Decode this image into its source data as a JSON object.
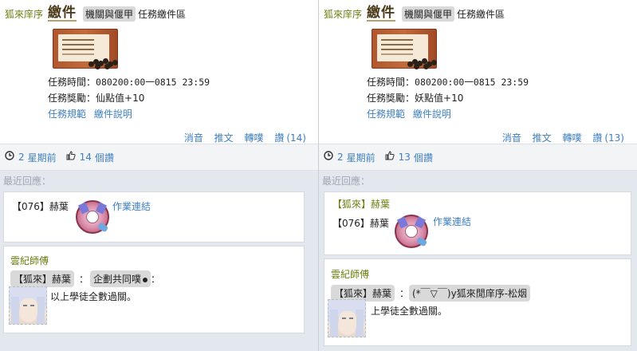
{
  "left": {
    "author": "狐來庠序",
    "logo": "繳件",
    "tag": "機關與偃甲",
    "area": "任務繳件區",
    "time_label": "任務時間：",
    "time_value": "080200:00一0815 23:59",
    "reward_label": "任務獎勵：",
    "reward_value": "仙點值+10",
    "rules_link": "任務規範",
    "guide_link": "繳件說明",
    "actions": {
      "mute": "消音",
      "tweet": "推文",
      "repost": "轉噗",
      "like": "讚",
      "like_count": "(14)"
    },
    "meta": {
      "time_num": "2",
      "time_unit": "星期前",
      "like_num": "14",
      "like_unit": "個讚"
    },
    "recent_label": "最近回應：",
    "reply1": {
      "tag": "【076】赫葉",
      "link": "作業連結"
    },
    "reply2": {
      "teacher": "雲紀師傅",
      "chip1": "【狐來】赫葉",
      "chip2": "企劃共同噗",
      "message": "以上學徒全數過關。"
    }
  },
  "right": {
    "author": "狐來庠序",
    "logo": "繳件",
    "tag": "機關與偃甲",
    "area": "任務繳件區",
    "time_label": "任務時間：",
    "time_value": "080200:00一0815 23:59",
    "reward_label": "任務獎勵：",
    "reward_value": "妖點值+10",
    "rules_link": "任務規範",
    "guide_link": "繳件說明",
    "actions": {
      "mute": "消音",
      "tweet": "推文",
      "repost": "轉噗",
      "like": "讚",
      "like_count": "(13)"
    },
    "meta": {
      "time_num": "2",
      "time_unit": "星期前",
      "like_num": "13",
      "like_unit": "個讚"
    },
    "recent_label": "最近回應：",
    "reply1": {
      "tag_top": "【狐來】赫葉",
      "tag": "【076】赫葉",
      "link": "作業連結"
    },
    "reply2": {
      "teacher": "雲紀師傅",
      "chip1": "【狐來】赫葉",
      "chip2": "(*￣▽￣)y狐來閒庠序-松烟",
      "message": "上學徒全數過關。"
    }
  },
  "icons": {
    "clock": "clock-icon",
    "thumb": "thumbs-up-icon"
  },
  "colors": {
    "link": "#3f7fbf",
    "author": "#6b7f10",
    "chip": "#d9d9d9"
  }
}
